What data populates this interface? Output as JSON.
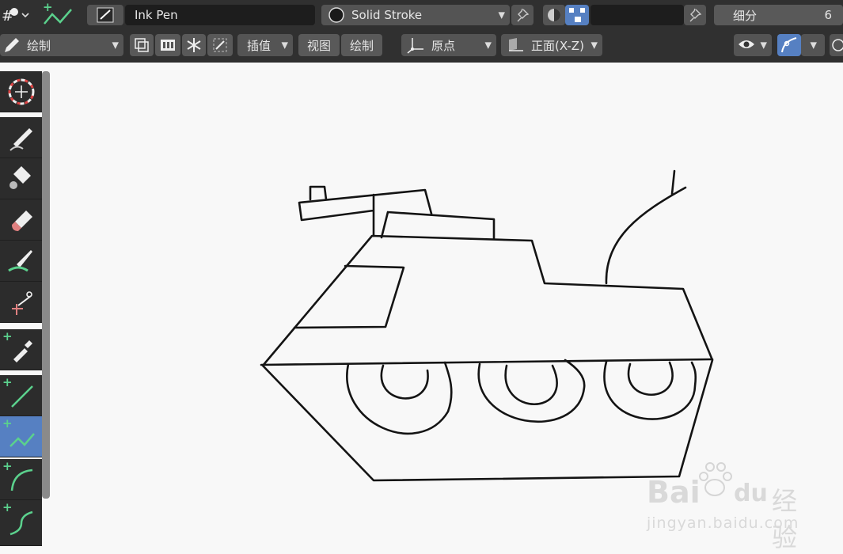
{
  "topbar": {
    "brush_name": "Ink Pen",
    "stroke_material": "Solid Stroke",
    "subdivide_label": "细分",
    "subdivide_value": "6"
  },
  "header": {
    "mode_label": "绘制",
    "interpolate_label": "插值",
    "view_tab": "视图",
    "draw_tab": "绘制",
    "origin_label": "原点",
    "plane_label": "正面(X-Z)"
  },
  "toolbar": {
    "tools": [
      "cursor",
      "draw",
      "fill",
      "erase",
      "tint",
      "cutter",
      "eyedropper",
      "line",
      "polyline",
      "arc",
      "curve"
    ],
    "active_tool": "polyline"
  },
  "watermark": {
    "brand": "Bai",
    "brand_tail": "du",
    "cn": "经验",
    "url": "jingyan.baidu.com"
  },
  "colors": {
    "accent": "#5680c2",
    "add_plus": "#5bd18d"
  }
}
